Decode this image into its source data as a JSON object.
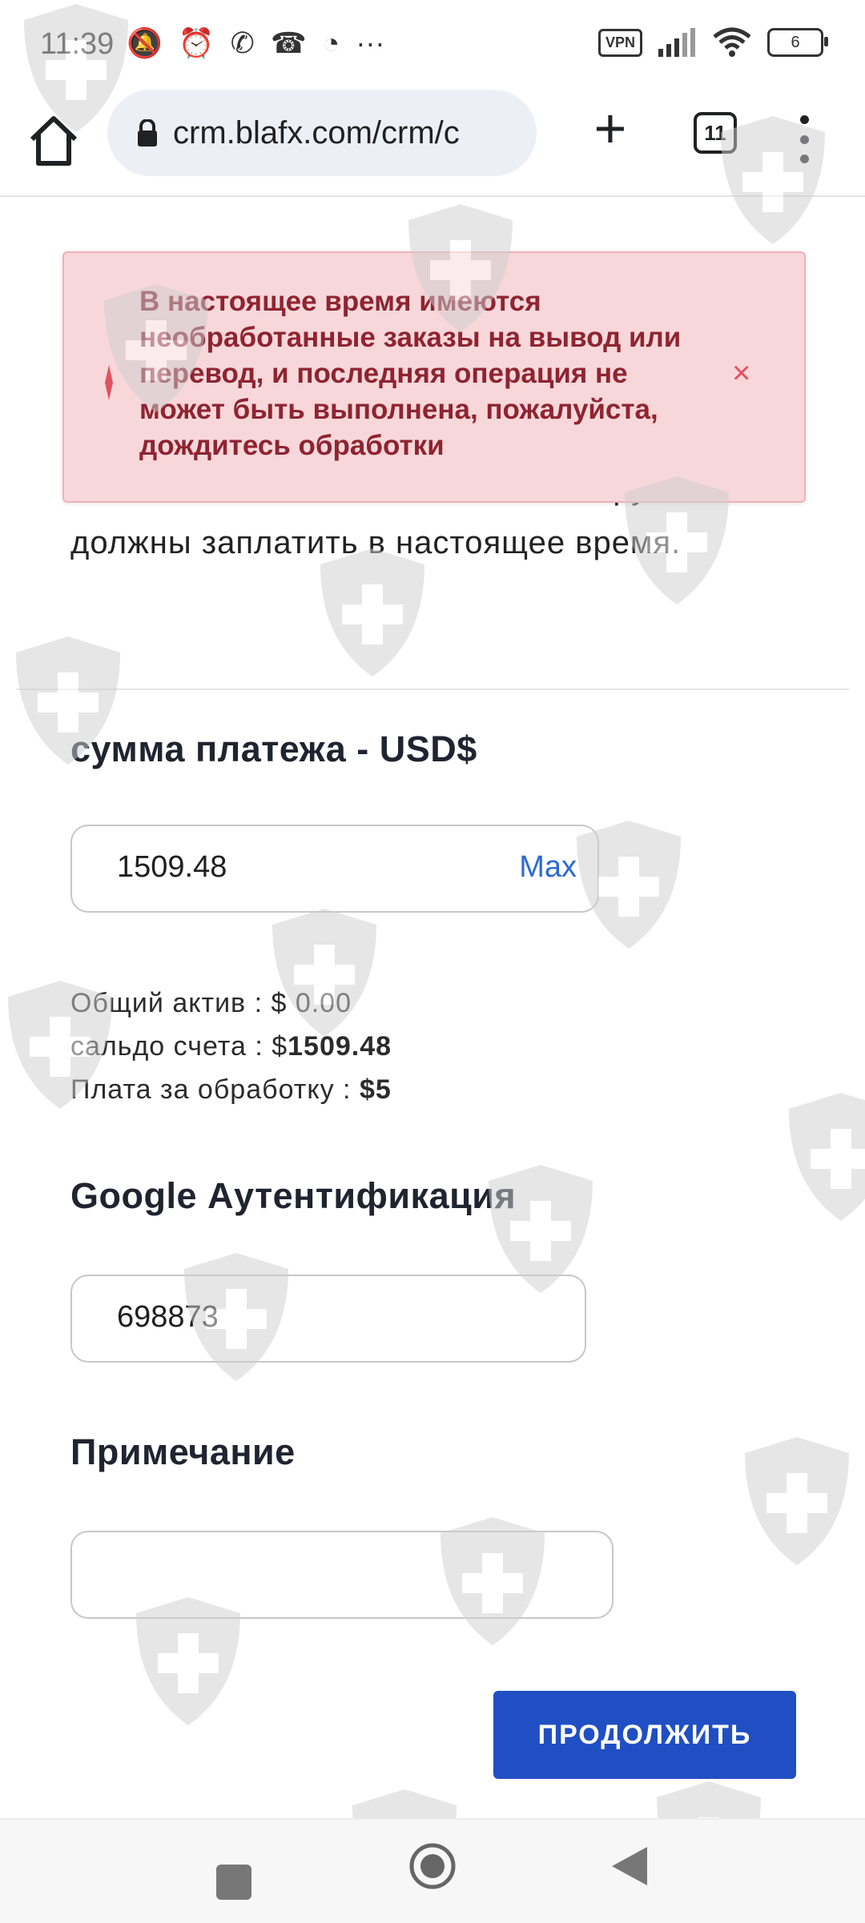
{
  "status_bar": {
    "time": "11:39",
    "battery": "6",
    "vpn": "VPN"
  },
  "browser": {
    "url": "crm.blafx.com/crm/c",
    "tab_count": "11"
  },
  "page": {
    "cut_text_top": "",
    "description": "кнопки \"Снять\", это комиссия, которую вы должны заплатить в настоящее время.",
    "alert": {
      "message": "В настоящее время имеются необработанные заказы на вывод или перевод, и последняя операция не может быть выполнена, пожалуйста, дождитесь обработки",
      "close": "×"
    },
    "payment": {
      "title": "сумма платежа - USD$",
      "value": "1509.48",
      "max_label": "Max"
    },
    "info": {
      "total_assets_label": "Общий актив : ",
      "total_assets_value": "$ 0.00",
      "balance_label": "сальдо счета : $",
      "balance_value": "1509.48",
      "fee_label": "Плата за обработку : ",
      "fee_value": "$5"
    },
    "google_auth": {
      "title": "Google Аутентификация",
      "value": "698873"
    },
    "note": {
      "title": "Примечание",
      "value": ""
    },
    "continue_label": "ПРОДОЛЖИТЬ"
  }
}
